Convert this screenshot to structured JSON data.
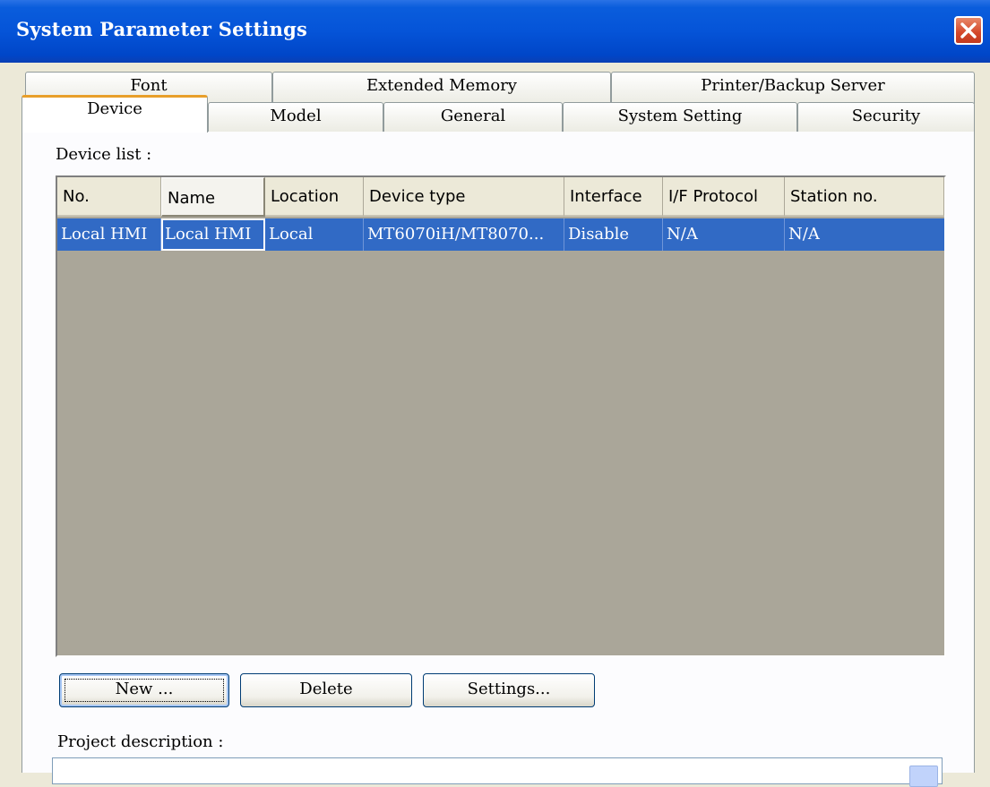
{
  "window": {
    "title": "System Parameter Settings"
  },
  "tabs_row1": [
    {
      "label": "Font"
    },
    {
      "label": "Extended Memory"
    },
    {
      "label": "Printer/Backup Server"
    }
  ],
  "tabs_row2": [
    {
      "label": "Device",
      "active": true
    },
    {
      "label": "Model"
    },
    {
      "label": "General"
    },
    {
      "label": "System Setting"
    },
    {
      "label": "Security"
    }
  ],
  "device_list": {
    "label": "Device list :",
    "columns": [
      "No.",
      "Name",
      "Location",
      "Device type",
      "Interface",
      "I/F Protocol",
      "Station no."
    ],
    "rows": [
      [
        "Local HMI",
        "Local HMI",
        "Local",
        "MT6070iH/MT8070...",
        "Disable",
        "N/A",
        "N/A"
      ]
    ]
  },
  "buttons": {
    "new": "New ...",
    "delete": "Delete",
    "settings": "Settings..."
  },
  "project_description": {
    "label": "Project description :"
  }
}
